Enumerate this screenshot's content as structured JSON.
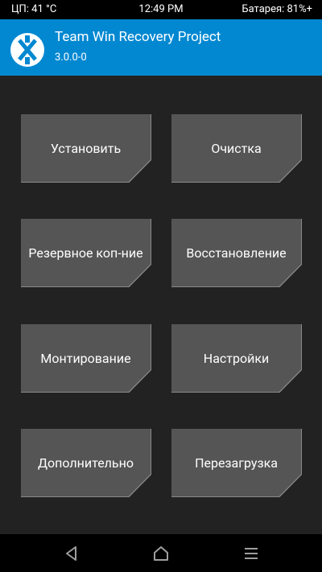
{
  "status_bar": {
    "cpu": "ЦП: 41 °C",
    "time": "12:49 PM",
    "battery": "Батарея: 81%+"
  },
  "header": {
    "title": "Team Win Recovery Project",
    "version": "3.0.0-0"
  },
  "menu": {
    "install": "Установить",
    "wipe": "Очистка",
    "backup": "Резервное коп-ние",
    "restore": "Восстановление",
    "mount": "Монтирование",
    "settings": "Настройки",
    "advanced": "Дополнительно",
    "reboot": "Перезагрузка"
  },
  "nav": {
    "back": "back-icon",
    "home": "home-icon",
    "menu": "menu-icon"
  },
  "colors": {
    "header": "#0288d1",
    "background": "#222222",
    "tile": "#555555",
    "status_bar": "#000000"
  }
}
